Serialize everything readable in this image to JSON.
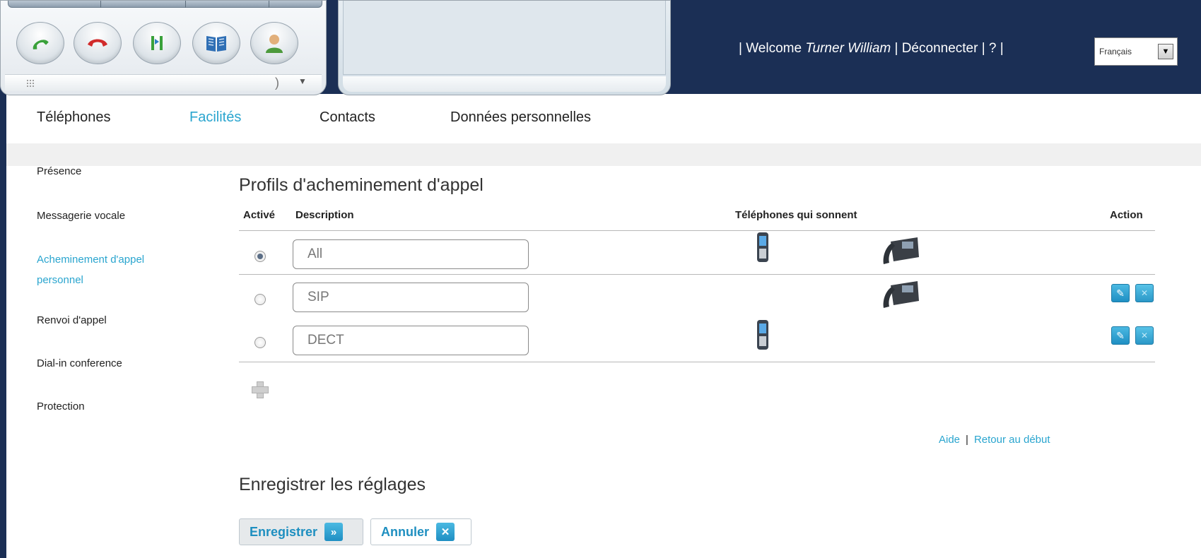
{
  "header": {
    "welcome_prefix": "| Welcome",
    "user_name": "Turner William",
    "logout_text": "| Déconnecter | ? |",
    "language": "Français"
  },
  "softphone": {
    "buttons": [
      "answer-call",
      "hang-up",
      "transfer",
      "directory",
      "contact"
    ]
  },
  "tabs": [
    "Téléphones",
    "Facilités",
    "Contacts",
    "Données personnelles"
  ],
  "active_tab": "Facilités",
  "sidebar": {
    "items": [
      "Présence",
      "Messagerie vocale",
      "Acheminement d'appel",
      "personnel",
      "Renvoi d'appel",
      "Dial-in conference",
      "Protection"
    ]
  },
  "routing": {
    "title": "Profils d'acheminement d'appel",
    "columns": {
      "active": "Activé",
      "description": "Description",
      "phones": "Téléphones qui sonnent",
      "action": "Action"
    },
    "rows": [
      {
        "active": true,
        "description": "All",
        "dect": true,
        "desk": true,
        "actions": false
      },
      {
        "active": false,
        "description": "SIP",
        "dect": false,
        "desk": true,
        "actions": true
      },
      {
        "active": false,
        "description": "DECT",
        "dect": true,
        "desk": false,
        "actions": true
      }
    ]
  },
  "help_links": {
    "help": "Aide",
    "back_to_top": "Retour au début"
  },
  "save_section": {
    "title": "Enregistrer les réglages",
    "save_label": "Enregistrer",
    "cancel_label": "Annuler"
  }
}
